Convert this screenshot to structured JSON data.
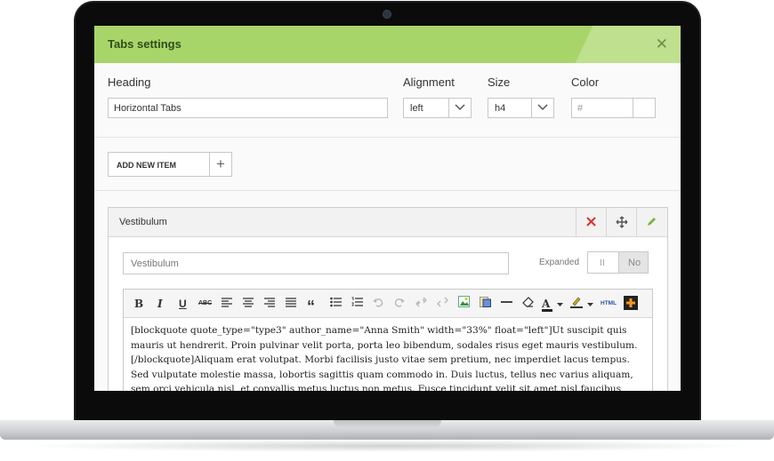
{
  "dialog": {
    "title": "Tabs settings",
    "close_glyph": "✕"
  },
  "fields": {
    "heading_label": "Heading",
    "heading_value": "Horizontal Tabs",
    "alignment_label": "Alignment",
    "alignment_value": "left",
    "size_label": "Size",
    "size_value": "h4",
    "color_label": "Color",
    "color_placeholder": "#"
  },
  "add_item": {
    "label": "ADD NEW ITEM",
    "plus": "+"
  },
  "item": {
    "title": "Vestibulum",
    "title_input_value": "Vestibulum",
    "expanded_label": "Expanded",
    "toggle_value": "No"
  },
  "toolbar": {
    "bold": "B",
    "italic": "I",
    "underline": "U",
    "strike": "ABC",
    "quote": "“",
    "html": "HTML"
  },
  "editor": {
    "content": "[blockquote quote_type=\"type3\" author_name=\"Anna Smith\" width=\"33%\" float=\"left\"]Ut suscipit quis mauris ut hendrerit. Proin pulvinar velit porta, porta leo bibendum, sodales risus eget mauris vestibulum.[/blockquote]Aliquam erat volutpat. Morbi facilisis justo vitae sem pretium, nec imperdiet lacus tempus. Sed vulputate molestie massa, lobortis sagittis quam commodo in. Duis luctus, tellus nec varius aliquam, sem orci vehicula nisl, et convallis metus luctus non metus. Fusce tincidunt velit sit amet nisl faucibus sodales ante quis vel pharetra erat, ac dictum arcu."
  },
  "colors": {
    "title_bar": "#a8d56a",
    "delete_icon": "#d9322b",
    "edit_icon": "#7cb33a"
  }
}
